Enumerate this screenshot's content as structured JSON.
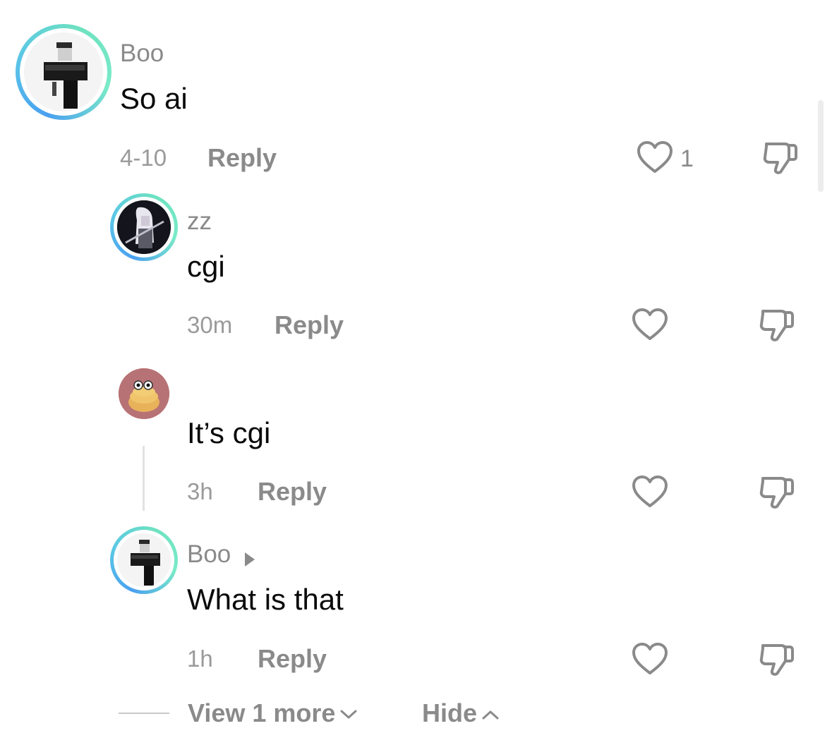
{
  "comments": [
    {
      "username": "Boo",
      "text": "So ai",
      "time": "4-10",
      "reply_label": "Reply",
      "like_count": "1"
    },
    {
      "username": "zz",
      "text": "cgi",
      "time": "30m",
      "reply_label": "Reply"
    },
    {
      "username": "",
      "text": "It’s cgi",
      "time": "3h",
      "reply_label": "Reply"
    },
    {
      "username": "Boo",
      "text": "What is that",
      "time": "1h",
      "reply_label": "Reply"
    }
  ],
  "footer": {
    "view_more_label": "View 1 more",
    "hide_label": "Hide"
  },
  "icons": {
    "like": "heart-outline-icon",
    "dislike": "thumbs-down-outline-icon",
    "expand": "chevron-down-icon",
    "collapse": "chevron-up-icon",
    "reply_to": "play-arrow-icon"
  },
  "colors": {
    "avatar_ring_start": "#4aa0f0",
    "avatar_ring_end": "#6ee2c0",
    "muted_text": "#8a8a8a"
  }
}
